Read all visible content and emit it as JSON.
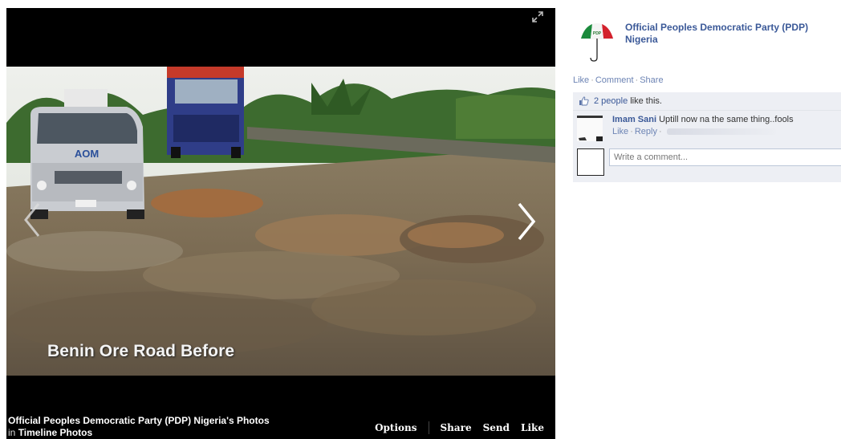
{
  "viewer": {
    "caption": "Benin Ore Road Before",
    "album_owner": "Official Peoples Democratic Party (PDP) Nigeria's Photos",
    "album_in": "in",
    "album_name": "Timeline Photos",
    "actions": {
      "options": "Options",
      "share": "Share",
      "send": "Send",
      "like": "Like"
    },
    "van_text": "AOM"
  },
  "side": {
    "page_name": "Official Peoples Democratic Party (PDP) Nigeria",
    "logo_text": "PDP",
    "actions": {
      "like": "Like",
      "comment": "Comment",
      "share": "Share",
      "separator": "·"
    },
    "likes": {
      "people": "2 people",
      "suffix": "like this."
    },
    "comment": {
      "author": "Imam Sani",
      "text": "Uptill now na the same thing..fools",
      "like": "Like",
      "reply": "Reply"
    },
    "write_placeholder": "Write a comment..."
  },
  "colors": {
    "link_blue": "#3b5998",
    "ufi_background": "#edeff4",
    "viewer_background": "#000000",
    "logo_red": "#d3212c",
    "logo_green": "#1b8a3c"
  },
  "icons": {
    "expand": "expand-icon",
    "prev": "chevron-left-icon",
    "next": "chevron-right-icon",
    "like": "thumbs-up-icon",
    "logo": "pdp-umbrella-logo"
  }
}
